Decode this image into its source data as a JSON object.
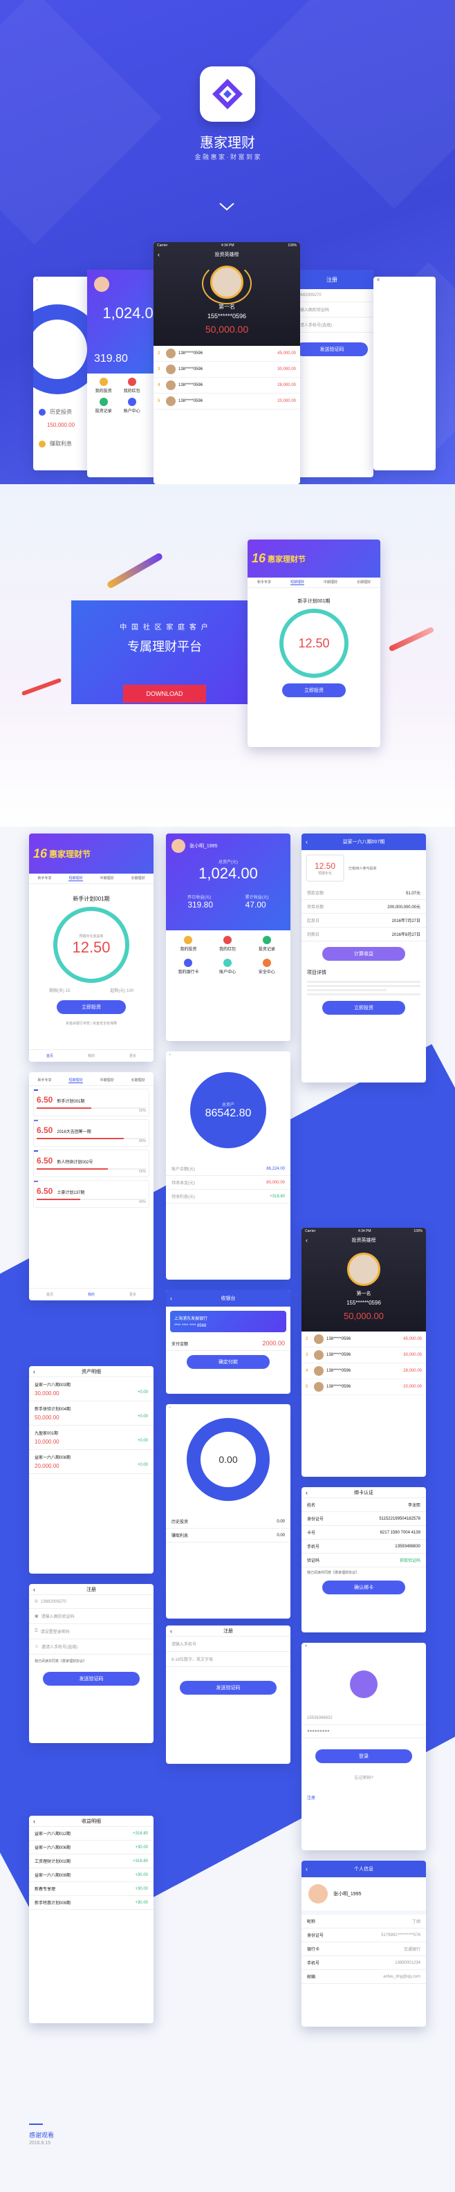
{
  "colors": {
    "brand_blue": "#3d56e6",
    "purple": "#6a3ef0",
    "red": "#e94a4a",
    "teal": "#49d0c0",
    "gold": "#f0b23a"
  },
  "hero": {
    "app_name": "惠家理财",
    "slogan": "金 融 惠 家 · 财 富 到 家",
    "logo_icon": "diamond-logo-icon",
    "scroll_icon": "chevron-down-icon"
  },
  "banner": {
    "line1": "中 国 社 区 家 庭 客 户",
    "line2": "专属理财平台",
    "download_label": "DOWNLOAD"
  },
  "status": {
    "carrier": "Carrier",
    "time": "4:34 PM",
    "battery": "100%"
  },
  "home": {
    "festival": "惠家理财节",
    "badge": "16",
    "tabs": [
      "新手专享",
      "短期理财",
      "中期理财",
      "长期理财"
    ],
    "product_name": "新手计划001期",
    "rate_label": "预期年化收益率",
    "rate": "12.50",
    "rate_unit": "%",
    "term": "期限(天) 15",
    "min": "起购(元) 100",
    "invest_label": "立即投资",
    "safe_note": "资金由银行存管 | 资金安全有保障",
    "tab_items": [
      "首页",
      "我的",
      "更多"
    ]
  },
  "assets": {
    "user": "张小明_1995",
    "total_label": "总资产(元)",
    "total": "1,024.00",
    "yesterday_label": "昨日收益(元)",
    "yesterday": "319.80",
    "accum_label": "累计收益(元)",
    "accum": "47.00",
    "menu": [
      "我的投资",
      "我的红包",
      "投资记录",
      "我的银行卡",
      "账户中心",
      "安全中心"
    ],
    "history_label": "历史投资",
    "interest_label": "赚取利息",
    "principal": "150,000.00"
  },
  "detail": {
    "title": "益家一六八期007期",
    "rate": "12.50",
    "rate_label": "预期年化",
    "tag": "已有88人参与投资",
    "rows": [
      {
        "k": "借款金额",
        "v": "51.07元"
      },
      {
        "k": "项目总额",
        "v": "200,000,000.00元"
      },
      {
        "k": "起息日",
        "v": "2016年7月27日"
      },
      {
        "k": "到期日",
        "v": "2016年8月27日"
      }
    ],
    "calc_label": "计算收益",
    "desc_title": "项目详情",
    "invest_label": "立即投资"
  },
  "products": {
    "items": [
      {
        "name": "新手计划001期",
        "rate": "6.50",
        "note": "50%"
      },
      {
        "name": "2016大吉团筹一期",
        "rate": "6.50",
        "note": "80%"
      },
      {
        "name": "新人特供计划002号",
        "rate": "6.50",
        "note": "65%"
      },
      {
        "name": "土豪计划137期",
        "rate": "6.50",
        "note": "40%"
      }
    ]
  },
  "assets_total": {
    "title": "总资产",
    "amount": "86542.80",
    "rows": [
      {
        "k": "账户余额(元)",
        "v": "86,224.00",
        "cls": "blue"
      },
      {
        "k": "待收本金(元)",
        "v": "80,000.00",
        "cls": "red"
      },
      {
        "k": "待收利息(元)",
        "v": "+316.80",
        "cls": "green"
      }
    ]
  },
  "ranking": {
    "title": "投资英雄榜",
    "champion_label": "第一名",
    "champion_phone": "155******0596",
    "champion_amount": "50,000.00",
    "rows": [
      {
        "rank": "2",
        "phone": "138*****0596",
        "amount": "45,000.00"
      },
      {
        "rank": "3",
        "phone": "138*****0596",
        "amount": "30,000.00"
      },
      {
        "rank": "4",
        "phone": "138*****0596",
        "amount": "28,000.00"
      },
      {
        "rank": "5",
        "phone": "138*****0596",
        "amount": "20,000.00"
      }
    ]
  },
  "asset_detail": {
    "title": "资产明细",
    "items": [
      {
        "name": "益家一六八期003期",
        "a": "30,000.00",
        "b": "+0.00"
      },
      {
        "name": "新手体验计划004期",
        "a": "50,000.00",
        "b": "+0.00"
      },
      {
        "name": "九盈家001期",
        "a": "10,000.00",
        "b": "+0.00"
      },
      {
        "name": "益家一六八期008期",
        "a": "20,000.00",
        "b": "+0.00"
      }
    ]
  },
  "checkout": {
    "title": "收银台",
    "bank": "上海浦东发展银行",
    "card": "**** **** **** 8568",
    "pay_label": "支付金额",
    "amount": "2000.00",
    "confirm_label": "确定付款"
  },
  "bindcard": {
    "title": "绑卡认证",
    "name_label": "姓名",
    "name": "李龙熙",
    "id_label": "身份证号",
    "id": "511522199504182578",
    "card_label": "卡号",
    "card": "6217 1580 7004 4139",
    "phone_label": "手机号",
    "phone": "13593498830",
    "code_label": "验证码",
    "send_label": "获取验证码",
    "agree": "我已阅读并同意《惠家理财协议》",
    "submit": "确认绑卡"
  },
  "register": {
    "title": "注册",
    "phone": "13682009270",
    "code_placeholder": "请输入图形验证码",
    "pwd_placeholder": "请设置登录密码",
    "ref_placeholder": "邀请人手机号(选填)",
    "agree": "我已阅读并同意《惠家理财协议》",
    "submit": "发送验证码"
  },
  "my_invest": {
    "amount": "0.00",
    "history_label": "历史投资",
    "earn_label": "赚取利息",
    "value": "0.00"
  },
  "login": {
    "phone": "15536366632",
    "pwd": "●●●●●●●●●",
    "submit": "登录",
    "forgot": "忘记密码?",
    "register": "注册"
  },
  "register2": {
    "title": "注册",
    "phone_placeholder": "请输入手机号",
    "pwd_placeholder": "6-18位数字、英文字母",
    "submit": "发送验证码"
  },
  "income": {
    "title": "收益明细",
    "items": [
      {
        "name": "益家一六八期012期",
        "v": "+316.80"
      },
      {
        "name": "益家一六八期006期",
        "v": "+30.00"
      },
      {
        "name": "工资理财计划002期",
        "v": "+316.80"
      },
      {
        "name": "益家一六八期009期",
        "v": "+30.00"
      },
      {
        "name": "新春专享理",
        "v": "+30.00"
      },
      {
        "name": "新手特惠计划009期",
        "v": "+30.00"
      }
    ]
  },
  "profile": {
    "title": "个人信息",
    "user": "张小明_1995",
    "rows": [
      {
        "k": "昵称",
        "v": "丁胡"
      },
      {
        "k": "身份证号",
        "v": "51?9991**********576"
      },
      {
        "k": "银行卡",
        "v": "交通银行"
      },
      {
        "k": "手机号",
        "v": "13890001234"
      },
      {
        "k": "邮箱",
        "v": "anfas_dng@qq.com"
      }
    ]
  },
  "footer": {
    "line1": "感谢观看",
    "line2": "2016.8.15"
  }
}
